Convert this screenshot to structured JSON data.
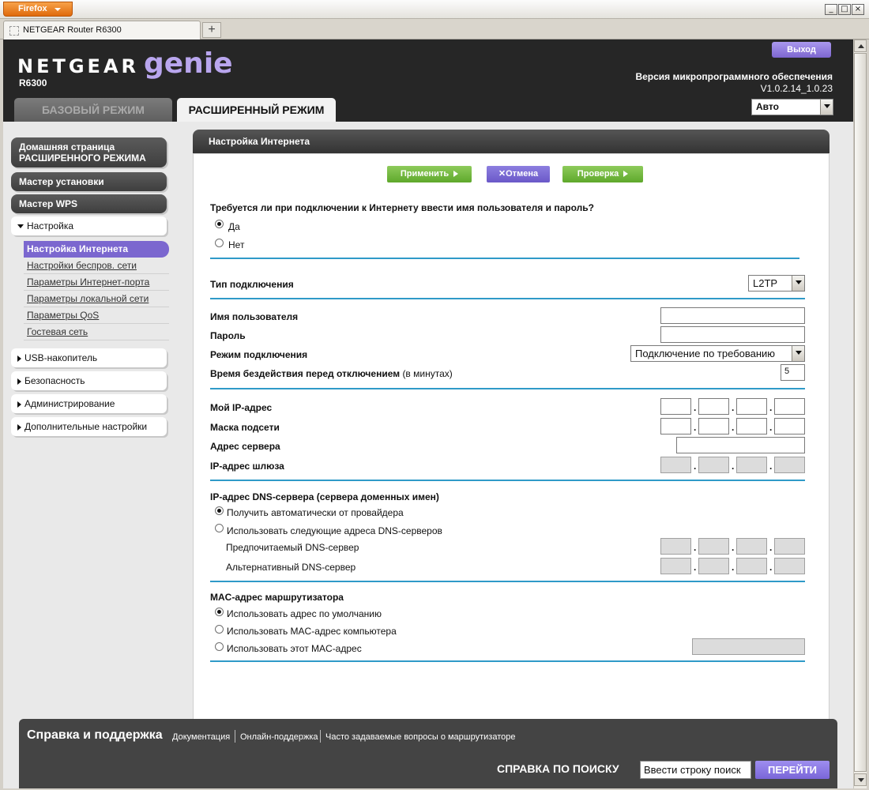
{
  "browser": {
    "menu_button": "Firefox",
    "tab_title": "NETGEAR Router R6300",
    "new_tab": "+",
    "min": "_",
    "max": "□",
    "close": "×"
  },
  "header": {
    "brand": "NETGEAR",
    "brand_product": "genie",
    "model": "R6300",
    "logout": "Выход",
    "firmware_label": "Версия микропрограммного обеспечения",
    "firmware_version": "V1.0.2.14_1.0.23",
    "tab_basic": "БАЗОВЫЙ РЕЖИМ",
    "tab_advanced": "РАСШИРЕННЫЙ РЕЖИМ",
    "language": "Авто"
  },
  "sidebar": {
    "home": "Домашняя страница РАСШИРЕННОГО РЕЖИМА",
    "setup_wizard": "Мастер установки",
    "wps_wizard": "Мастер WPS",
    "setup": "Настройка",
    "setup_items": [
      "Настройка Интернета",
      "Настройки беспров. сети",
      "Параметры Интернет-порта",
      "Параметры локальной сети",
      "Параметры QoS",
      "Гостевая сеть"
    ],
    "usb": "USB-накопитель",
    "security": "Безопасность",
    "admin": "Администрирование",
    "advanced": "Дополнительные настройки"
  },
  "main": {
    "title": "Настройка Интернета",
    "apply": "Применить",
    "cancel": "Отмена",
    "test": "Проверка",
    "login_question": "Требуется ли при подключении к Интернету ввести имя пользователя и пароль?",
    "yes": "Да",
    "no": "Нет",
    "conn_type_label": "Тип подключения",
    "conn_type_value": "L2TP",
    "username_label": "Имя пользователя",
    "password_label": "Пароль",
    "conn_mode_label": "Режим подключения",
    "conn_mode_value": "Подключение по требованию",
    "idle_label": "Время бездействия перед отключением",
    "idle_unit": "(в минутах)",
    "idle_value": "5",
    "my_ip_label": "Мой IP-адрес",
    "subnet_label": "Маска подсети",
    "server_label": "Адрес сервера",
    "gateway_label": "IP-адрес шлюза",
    "dns_section": "IP-адрес DNS-сервера (сервера доменных имен)",
    "dns_auto": "Получить автоматически от провайдера",
    "dns_manual": "Использовать следующие адреса DNS-серверов",
    "dns_primary": "Предпочитаемый DNS-сервер",
    "dns_secondary": "Альтернативный DNS-сервер",
    "mac_section": "MAC-адрес маршрутизатора",
    "mac_default": "Использовать адрес по умолчанию",
    "mac_computer": "Использовать MAC-адрес компьютера",
    "mac_this": "Использовать этот MAC-адрес"
  },
  "footer": {
    "title": "Справка и поддержка",
    "links": [
      "Документация",
      "Онлайн-поддержка",
      "Часто задаваемые вопросы о маршрутизаторе"
    ],
    "search_label": "СПРАВКА ПО ПОИСКУ",
    "search_placeholder": "Ввести строку поиск",
    "go": "ПЕРЕЙТИ"
  }
}
